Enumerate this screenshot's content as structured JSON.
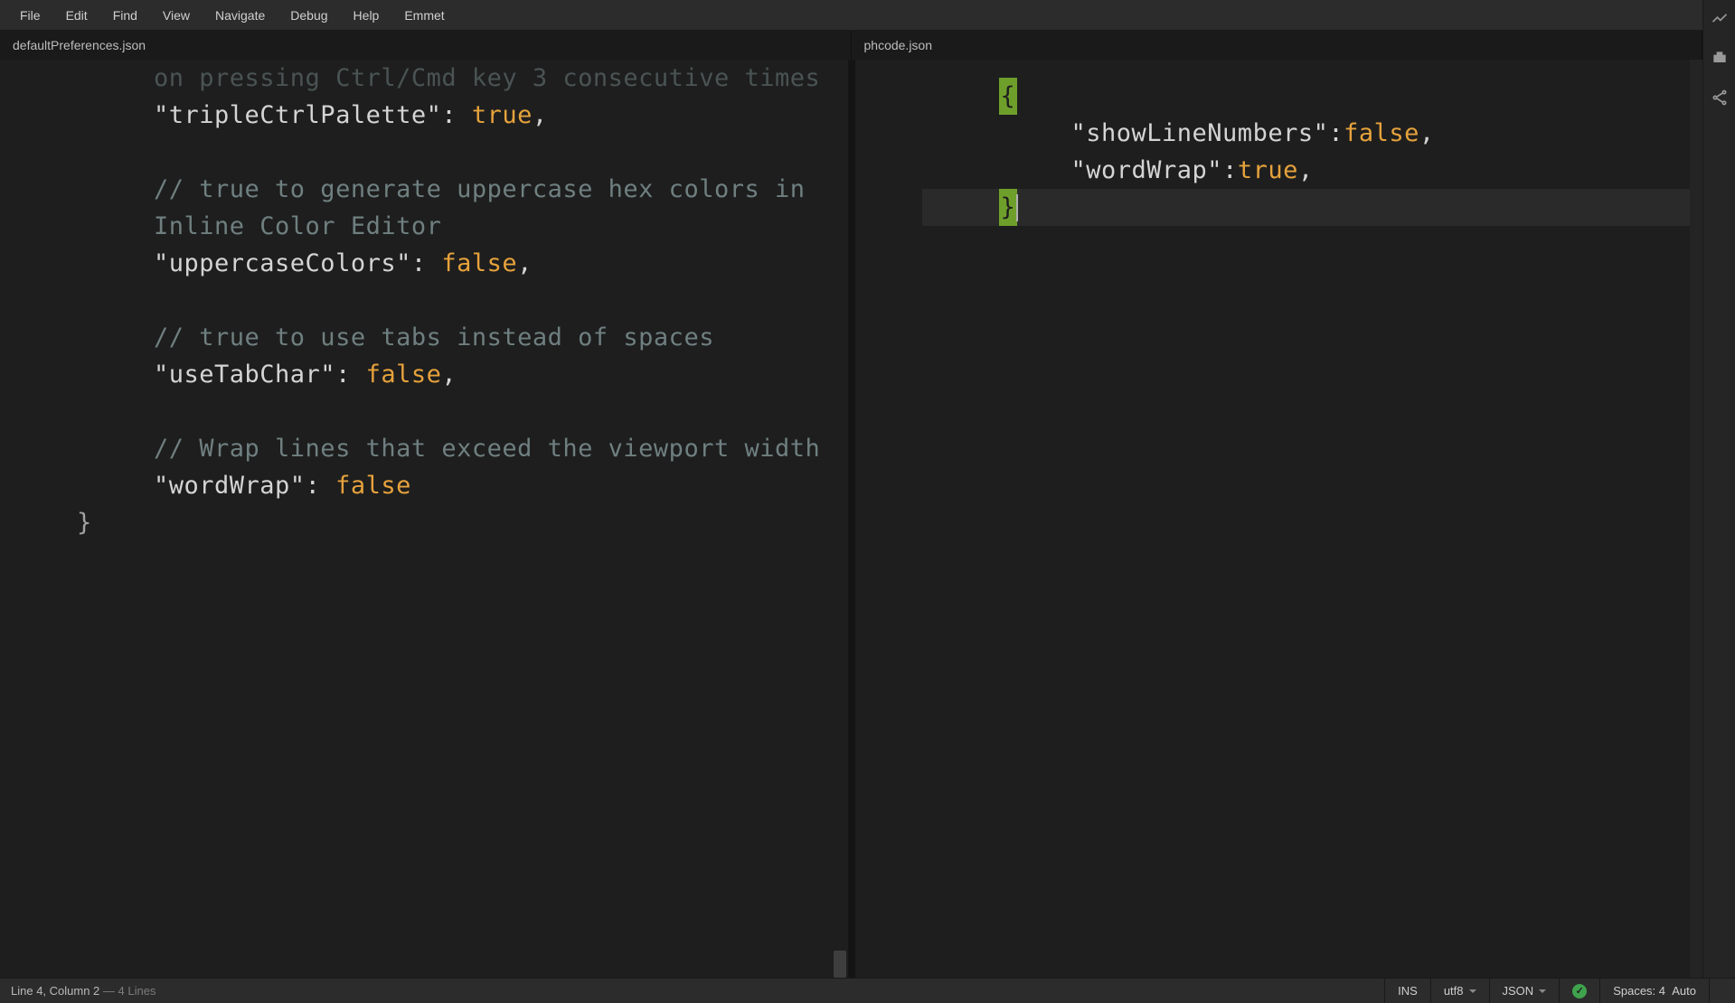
{
  "menubar": {
    "items": [
      "File",
      "Edit",
      "Find",
      "View",
      "Navigate",
      "Debug",
      "Help",
      "Emmet"
    ]
  },
  "tabs": {
    "left": "defaultPreferences.json",
    "right": "phcode.json"
  },
  "left_code": {
    "partial_top": "on pressing Ctrl/Cmd key 3 consecutive times",
    "l1_key": "\"tripleCtrlPalette\"",
    "l1_val": "true",
    "c2": "// true to generate uppercase hex colors in Inline Color Editor",
    "l2_key": "\"uppercaseColors\"",
    "l2_val": "false",
    "c3": "// true to use tabs instead of spaces",
    "l3_key": "\"useTabChar\"",
    "l3_val": "false",
    "c4": "// Wrap lines that exceed the viewport width",
    "l4_key": "\"wordWrap\"",
    "l4_val": "false",
    "close_brace": "}"
  },
  "right_code": {
    "open": "{",
    "l1_key": "\"showLineNumbers\"",
    "l1_val": "false",
    "l2_key": "\"wordWrap\"",
    "l2_val": "true",
    "close": "}"
  },
  "status": {
    "cursor": "Line 4, Column 2",
    "linecount": " — 4 Lines",
    "ins": "INS",
    "encoding": "utf8",
    "lang": "JSON",
    "indent": "Spaces: 4",
    "auto": "Auto"
  }
}
